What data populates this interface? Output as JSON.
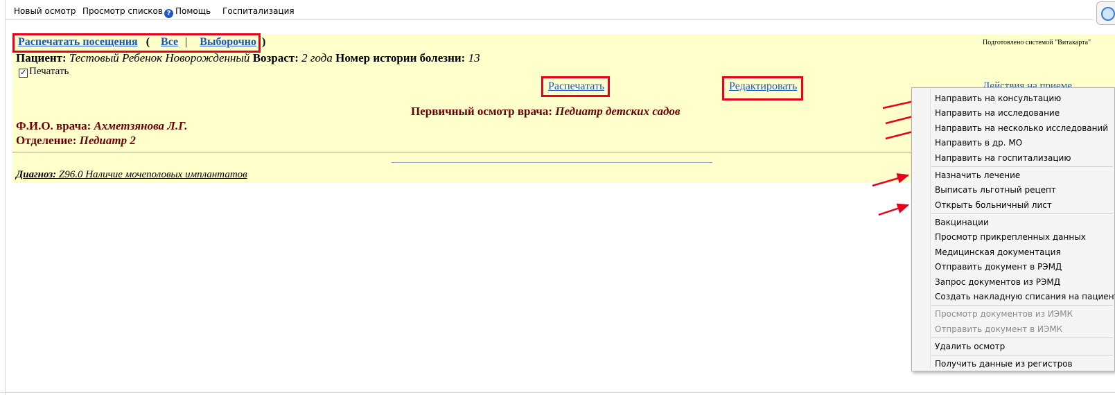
{
  "menu": {
    "new_exam": "Новый осмотр",
    "view_lists": "Просмотр списков",
    "help": "Помощь",
    "hospitalization": "Госпитализация"
  },
  "doc": {
    "print_visits": "Распечатать посещения",
    "open_paren": "(",
    "all": "Все",
    "pipe": "|",
    "selective": "Выборочно",
    "close_paren": ")",
    "prepared_by": "Подготовлено системой \"Витакарта\"",
    "patient_label": "Пациент:",
    "patient_name": "Тестовый Ребенок Новорожденный",
    "age_label": "Возраст:",
    "age_value": "2 года",
    "history_label": "Номер истории болезни:",
    "history_value": "13",
    "print_checkbox_label": "Печатать",
    "print_button": "Распечатать",
    "edit_button": "Редактировать",
    "actions_partial": "Действия на приеме",
    "exam_title_label": "Первичный осмотр врача:",
    "exam_title_value": "Педиатр детских садов",
    "doctor_label": "Ф.И.О. врача:",
    "doctor_value": "Ахметзянова Л.Г.",
    "dept_label": "Отделение:",
    "dept_value": "Педиатр 2",
    "diagnosis_label": "Диагноз:",
    "diagnosis_value": "Z96.0 Наличие мочеполовых имплантатов"
  },
  "context_menu": {
    "items": [
      {
        "label": "Направить на консультацию"
      },
      {
        "label": "Направить на исследование"
      },
      {
        "label": "Направить на несколько исследований"
      },
      {
        "label": "Направить в др. МО"
      },
      {
        "label": "Направить на госпитализацию"
      },
      {
        "label": "Назначить лечение"
      },
      {
        "label": "Выписать льготный рецепт"
      },
      {
        "label": "Открыть больничный лист"
      },
      {
        "label": "Вакцинации"
      },
      {
        "label": "Просмотр прикрепленных данных"
      },
      {
        "label": "Медицинская документация"
      },
      {
        "label": "Отправить документ в РЭМД"
      },
      {
        "label": "Запрос документов из РЭМД"
      },
      {
        "label": "Создать накладную списания на пациента"
      },
      {
        "label": "Просмотр документов из ИЭМК",
        "disabled": true
      },
      {
        "label": "Отправить документ в ИЭМК",
        "disabled": true
      },
      {
        "label": "Удалить осмотр"
      },
      {
        "label": "Получить данные из регистров"
      }
    ]
  },
  "colors": {
    "doc_background": "#ffffcc",
    "link": "#1a56c2",
    "heading_dark_red": "#6b0000",
    "highlight_red": "#e8001c"
  }
}
